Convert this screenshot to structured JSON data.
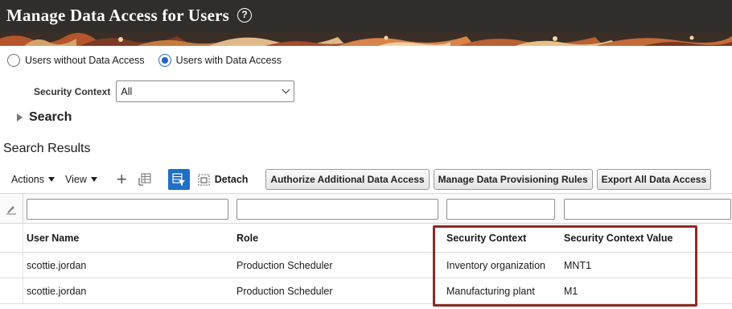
{
  "header": {
    "title": "Manage Data Access for Users",
    "help_glyph": "?"
  },
  "filters": {
    "radio_without": "Users without Data Access",
    "radio_with": "Users with Data Access",
    "selected": "with",
    "security_context_label": "Security Context",
    "security_context_value": "All",
    "search_label": "Search"
  },
  "results": {
    "title": "Search Results",
    "toolbar": {
      "actions": "Actions",
      "view": "View",
      "detach": "Detach",
      "authorize": "Authorize Additional Data Access",
      "provisioning": "Manage Data Provisioning Rules",
      "export": "Export All Data Access"
    },
    "columns": [
      "User Name",
      "Role",
      "Security Context",
      "Security Context Value"
    ],
    "rows": [
      {
        "user": "scottie.jordan",
        "role": "Production Scheduler",
        "context": "Inventory organization",
        "value": "MNT1"
      },
      {
        "user": "scottie.jordan",
        "role": "Production Scheduler",
        "context": "Manufacturing plant",
        "value": "M1"
      }
    ]
  },
  "colors": {
    "accent": "#1f6fc7",
    "banner": "#312d2a",
    "highlight": "#8e2a24"
  }
}
